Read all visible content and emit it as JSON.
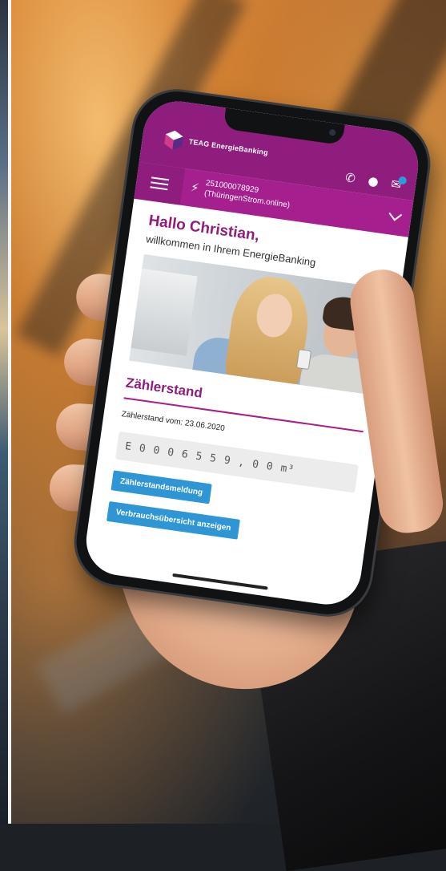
{
  "app": {
    "brand_name": "TEAG EnergieBanking",
    "brand_color": "#8e1d7d",
    "accent_color": "#2f96d6"
  },
  "header": {
    "icons": [
      "phone-icon",
      "user-icon",
      "mail-icon"
    ],
    "menu_icon": "hamburger-menu-icon"
  },
  "contract": {
    "number": "251000078929",
    "product": "(ThüringenStrom.online)"
  },
  "main": {
    "greeting": "Hallo Christian,",
    "welcome": "willkommen in Ihrem EnergieBanking",
    "section_title": "Zählerstand",
    "reading_date": "Zählerstand vom: 23.06.2020",
    "meter": {
      "prefix": "E",
      "digits": [
        "0",
        "0",
        "0",
        "6",
        "5",
        "5",
        "9"
      ],
      "separator": ",",
      "decimals": [
        "0",
        "0"
      ],
      "unit": "m³"
    },
    "buttons": {
      "report_label": "Zählerstandsmeldung",
      "consumption_label": "Verbrauchsübersicht anzeigen"
    }
  }
}
